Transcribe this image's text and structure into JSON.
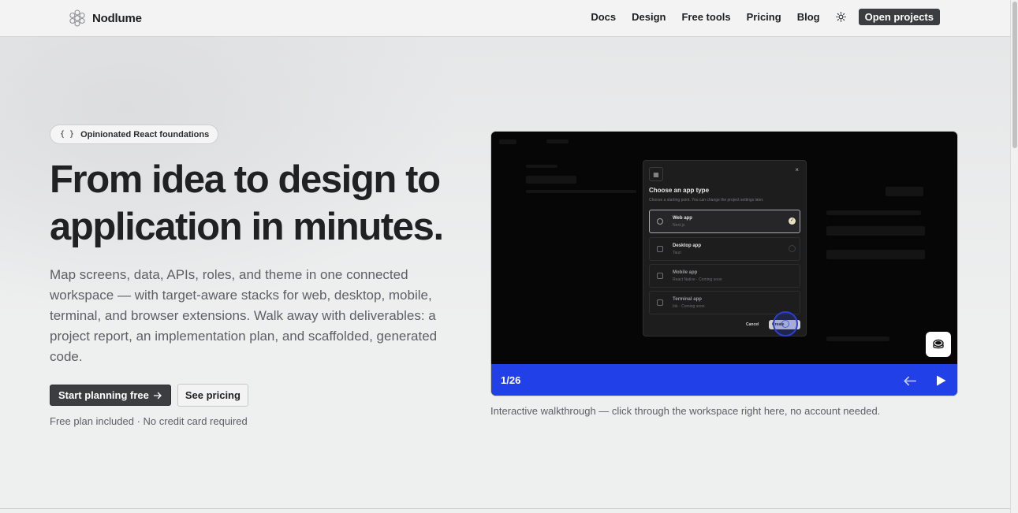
{
  "header": {
    "brand": "Nodlume",
    "nav": [
      {
        "label": "Docs"
      },
      {
        "label": "Design"
      },
      {
        "label": "Free tools"
      },
      {
        "label": "Pricing"
      },
      {
        "label": "Blog"
      }
    ],
    "theme_toggle_icon": "sun-icon",
    "open_projects_label": "Open projects"
  },
  "hero": {
    "badge_icon": "{ }",
    "badge_label": "Opinionated React foundations",
    "headline_line1": "From idea to design to",
    "headline_line2": "application in minutes.",
    "description": "Map screens, data, APIs, roles, and theme in one connected workspace — with target-aware stacks for web, desktop, mobile, terminal, and browser extensions. Walk away with deliverables: a project report, an implementation plan, and scaffolded, generated code.",
    "primary_cta": "Start planning free",
    "secondary_cta": "See pricing",
    "fineprint": "Free plan included · No credit card required"
  },
  "demo": {
    "modal": {
      "title": "Choose an app type",
      "subtitle": "Choose a starting point. You can change the project settings later.",
      "close": "×",
      "options": [
        {
          "name": "Web app",
          "meta": "Next.js",
          "selected": true
        },
        {
          "name": "Desktop app",
          "meta": "Tauri",
          "selected": false
        },
        {
          "name": "Mobile app",
          "meta": "React Native · Coming soon",
          "selected": false
        },
        {
          "name": "Terminal app",
          "meta": "Ink · Coming soon",
          "selected": false
        }
      ],
      "cancel_label": "Cancel",
      "create_label": "Create"
    },
    "counter": "1/26",
    "caption": "Interactive walkthrough — click through the workspace right here, no account needed."
  },
  "colors": {
    "accent_blue": "#2140e8",
    "dark_button": "#3b3d40"
  }
}
